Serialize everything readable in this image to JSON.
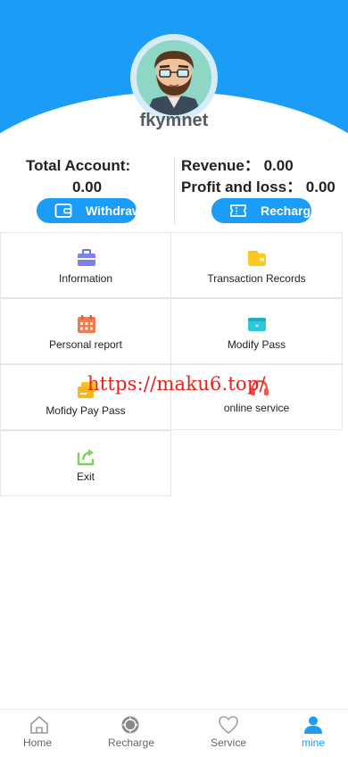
{
  "profile": {
    "username": "fkymnet"
  },
  "account": {
    "total_label": "Total Account:",
    "total_value": "0.00",
    "revenue_line": "Revenue： 0.00",
    "profit_line": "Profit and loss： 0.00",
    "withdraw_label": "Withdraw",
    "recharge_label": "Recharge"
  },
  "menu": {
    "items": [
      {
        "label": "Information",
        "icon": "briefcase-icon"
      },
      {
        "label": "Transaction Records",
        "icon": "wallet-icon"
      },
      {
        "label": "Personal report",
        "icon": "calendar-icon"
      },
      {
        "label": "Modify Pass",
        "icon": "card-icon"
      },
      {
        "label": "Mofidy Pay Pass",
        "icon": "pay-card-icon"
      },
      {
        "label": "online service",
        "icon": "headset-icon"
      },
      {
        "label": "Exit",
        "icon": "exit-icon"
      }
    ]
  },
  "watermark": "https://maku6.top/",
  "tabbar": {
    "items": [
      {
        "label": "Home",
        "icon": "home-icon"
      },
      {
        "label": "Recharge",
        "icon": "recharge-icon"
      },
      {
        "label": "Service",
        "icon": "heart-icon"
      },
      {
        "label": "mine",
        "icon": "user-icon",
        "active": true
      }
    ]
  },
  "colors": {
    "primary": "#1a9cf7",
    "watermark": "#e8201a"
  }
}
